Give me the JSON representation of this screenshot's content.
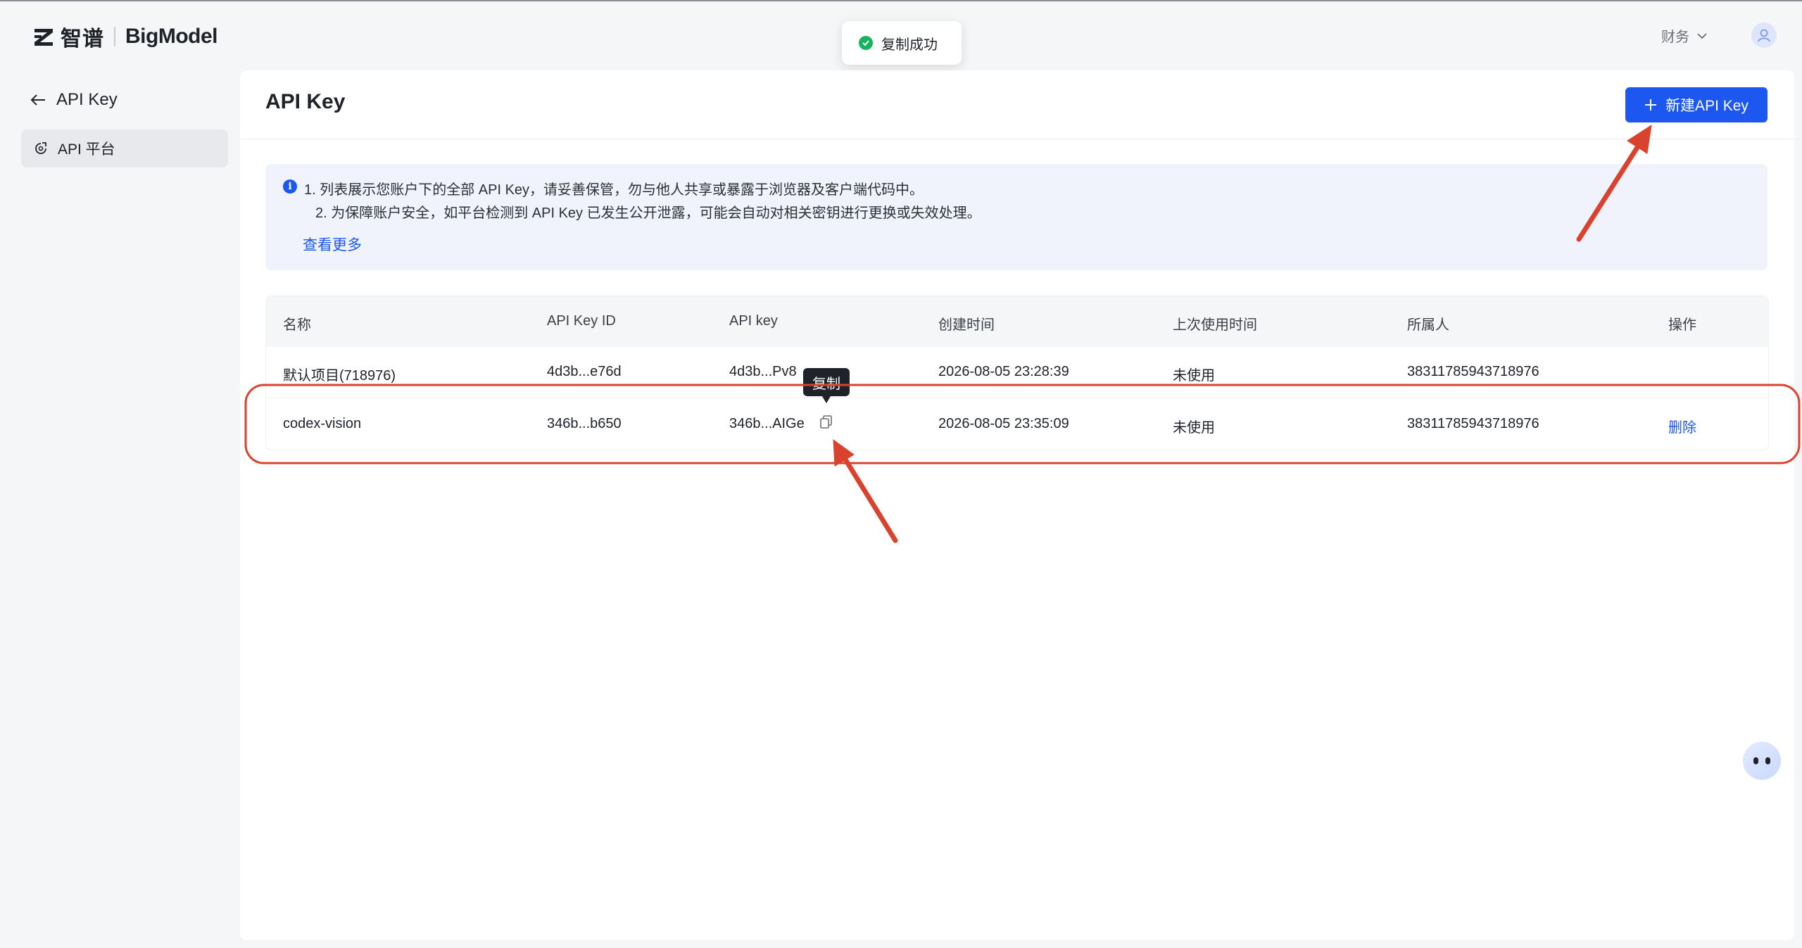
{
  "brand": {
    "name_cn": "智谱",
    "name_en": "BigModel",
    "logo_icon": "z-logo-icon"
  },
  "header": {
    "finance_menu": "财务",
    "avatar_icon": "user-avatar-icon"
  },
  "toast": {
    "text": "复制成功",
    "icon": "check-circle-icon",
    "color": "#18b35f"
  },
  "sidebar": {
    "back_label": "API Key",
    "items": [
      {
        "label": "API 平台",
        "icon": "api-platform-icon",
        "active": true
      }
    ]
  },
  "main": {
    "title": "API Key",
    "new_button": "新建API Key",
    "notice": {
      "line1": "1. 列表展示您账户下的全部 API Key，请妥善保管，勿与他人共享或暴露于浏览器及客户端代码中。",
      "line2": "2. 为保障账户安全，如平台检测到 API Key 已发生公开泄露，可能会自动对相关密钥进行更换或失效处理。",
      "link": "查看更多"
    },
    "table": {
      "columns": [
        "名称",
        "API Key ID",
        "API key",
        "创建时间",
        "上次使用时间",
        "所属人",
        "操作"
      ],
      "rows": [
        {
          "name": "默认项目(718976)",
          "key_id": "4d3b...e76d",
          "api_key": "4d3b...Pv8",
          "created": "2026-08-05 23:28:39",
          "last_used": "未使用",
          "owner": "38311785943718976",
          "action": ""
        },
        {
          "name": "codex-vision",
          "key_id": "346b...b650",
          "api_key": "346b...AIGe",
          "created": "2026-08-05 23:35:09",
          "last_used": "未使用",
          "owner": "38311785943718976",
          "action": "删除"
        }
      ]
    },
    "copy_tooltip": "复制"
  },
  "colors": {
    "accent": "#1c57f0",
    "annotation": "#d9432e"
  }
}
